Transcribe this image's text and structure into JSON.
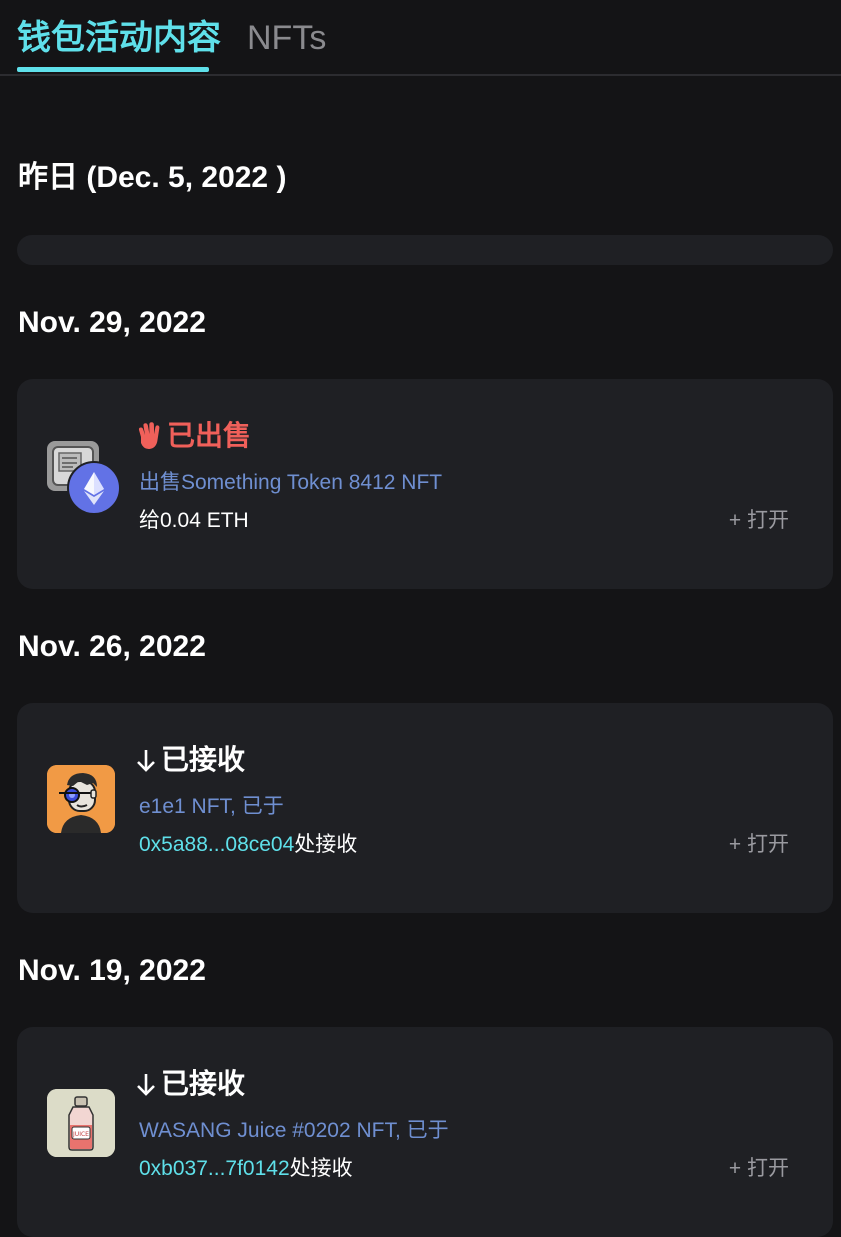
{
  "tabs": [
    {
      "label": "钱包活动内容",
      "active": true
    },
    {
      "label": "NFTs",
      "active": false
    }
  ],
  "groups": [
    {
      "date": "昨日 (Dec. 5, 2022 )"
    },
    {
      "date": "Nov. 29, 2022",
      "activity": {
        "type_label": "已出售",
        "type_icon": "waving-hand-icon",
        "description": "出售Something Token 8412 NFT",
        "detail": "给0.04 ETH",
        "open_label": "+ 打开"
      }
    },
    {
      "date": "Nov. 26, 2022",
      "activity": {
        "type_label": "已接收",
        "type_icon": "arrow-down-icon",
        "description": "e1e1 NFT, 已于",
        "address": "0x5a88...08ce04",
        "detail_suffix": "处接收",
        "open_label": "+ 打开"
      }
    },
    {
      "date": "Nov. 19, 2022",
      "activity": {
        "type_label": "已接收",
        "type_icon": "arrow-down-icon",
        "description": "WASANG Juice #0202 NFT, 已于",
        "address": "0xb037...7f0142",
        "detail_suffix": "处接收",
        "open_label": "+ 打开"
      }
    }
  ],
  "colors": {
    "background": "#141416",
    "card": "#1f2024",
    "accent": "#5fe0ea",
    "link_blue": "#6f8fd1",
    "sold_red": "#f0605a",
    "muted": "#9a9aa0"
  }
}
